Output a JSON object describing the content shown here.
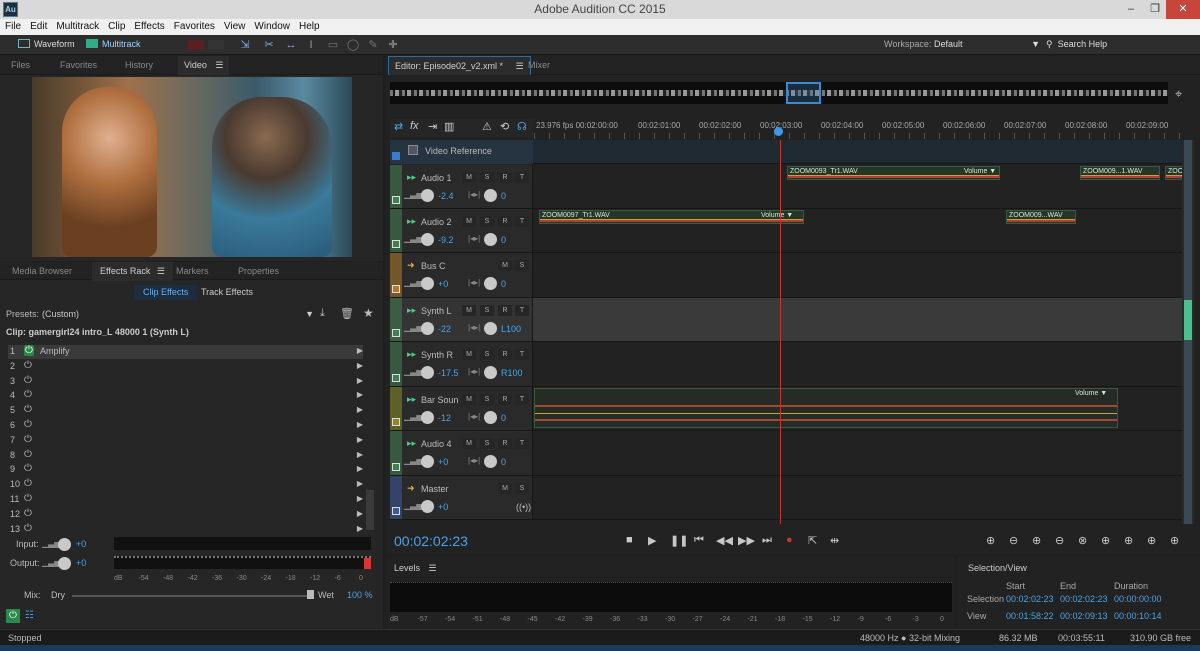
{
  "window": {
    "title": "Adobe Audition CC 2015",
    "app_icon": "Au",
    "minimize": "–",
    "restore": "❐",
    "close": "✕"
  },
  "menu": [
    "File",
    "Edit",
    "Multitrack",
    "Clip",
    "Effects",
    "Favorites",
    "View",
    "Window",
    "Help"
  ],
  "toolbar": {
    "waveform": "Waveform",
    "multitrack": "Multitrack",
    "workspace_label": "Workspace:",
    "workspace_value": "Default",
    "search_help": "Search Help"
  },
  "left_tabs": [
    "Files",
    "Favorites",
    "History",
    "Video"
  ],
  "rack_tabs": [
    "Media Browser",
    "Effects Rack",
    "Markers",
    "Properties"
  ],
  "rack": {
    "clip_effects": "Clip Effects",
    "track_effects": "Track Effects",
    "presets_label": "Presets:",
    "presets_value": "(Custom)",
    "clip_line": "Clip: gamergirl24 intro_L 48000 1 (Synth L)",
    "slots": [
      {
        "n": "1",
        "name": "Amplify"
      },
      {
        "n": "2",
        "name": ""
      },
      {
        "n": "3",
        "name": ""
      },
      {
        "n": "4",
        "name": ""
      },
      {
        "n": "5",
        "name": ""
      },
      {
        "n": "6",
        "name": ""
      },
      {
        "n": "7",
        "name": ""
      },
      {
        "n": "8",
        "name": ""
      },
      {
        "n": "9",
        "name": ""
      },
      {
        "n": "10",
        "name": ""
      },
      {
        "n": "11",
        "name": ""
      },
      {
        "n": "12",
        "name": ""
      },
      {
        "n": "13",
        "name": ""
      }
    ],
    "input_label": "Input:",
    "input_val": "+0",
    "output_label": "Output:",
    "output_val": "+0",
    "db_scale": [
      "dB",
      "-54",
      "-48",
      "-42",
      "-36",
      "-30",
      "-24",
      "-18",
      "-12",
      "-6",
      "0"
    ],
    "mix_label": "Mix:",
    "dry": "Dry",
    "wet": "Wet",
    "mix_pct": "100 %"
  },
  "editor_tabs": {
    "editor": "Editor: Episode02_v2.xml *",
    "mixer": "Mixer"
  },
  "ruler": {
    "fps": "23.976 fps 00:02:00:00",
    "ticks": [
      "00:02:01:00",
      "00:02:02:00",
      "00:02:03:00",
      "00:02:04:00",
      "00:02:05:00",
      "00:02:06:00",
      "00:02:07:00",
      "00:02:08:00",
      "00:02:09:00"
    ]
  },
  "video_ref": "Video Reference",
  "tracks": [
    {
      "name": "Audio 1",
      "vol": "-2.4",
      "pan": "0",
      "color": "#3f7f52"
    },
    {
      "name": "Audio 2",
      "vol": "-9.2",
      "pan": "0",
      "color": "#3f7f52"
    },
    {
      "name": "Bus C",
      "vol": "+0",
      "pan": "0",
      "color": "#b07a2c"
    },
    {
      "name": "Synth L",
      "vol": "-22",
      "pan": "L100",
      "color": "#3f7f52"
    },
    {
      "name": "Synth R",
      "vol": "-17.5",
      "pan": "R100",
      "color": "#3f7f52"
    },
    {
      "name": "Bar Soun",
      "vol": "-12",
      "pan": "0",
      "color": "#8a8a2a"
    },
    {
      "name": "Audio 4",
      "vol": "+0",
      "pan": "0",
      "color": "#3f7f52"
    },
    {
      "name": "Master",
      "vol": "+0",
      "pan": "",
      "color": "#3a5a9a"
    }
  ],
  "clips": {
    "c1": "ZOOM0093_Tr1.WAV",
    "c2": "ZOOM009...1.WAV",
    "c3": "ZOOM",
    "c4": "ZOOM0097_Tr1.WAV",
    "c5": "ZOOM009...WAV",
    "volume": "Volume"
  },
  "timecode": "00:02:02:23",
  "levels": {
    "title": "Levels",
    "scale": [
      "dB",
      "-57",
      "-54",
      "-51",
      "-48",
      "-45",
      "-42",
      "-39",
      "-36",
      "-33",
      "-30",
      "-27",
      "-24",
      "-21",
      "-18",
      "-15",
      "-12",
      "-9",
      "-6",
      "-3",
      "0"
    ]
  },
  "selection": {
    "title": "Selection/View",
    "start": "Start",
    "end": "End",
    "duration": "Duration",
    "sel_label": "Selection",
    "sel_start": "00:02:02:23",
    "sel_end": "00:02:02:23",
    "sel_dur": "00:00:00:00",
    "view_label": "View",
    "view_start": "00:01:58:22",
    "view_end": "00:02:09:13",
    "view_dur": "00:00:10:14"
  },
  "status": {
    "left": "Stopped",
    "rate": "48000 Hz ● 32-bit Mixing",
    "mem": "86.32 MB",
    "time": "00:03:55:11",
    "free": "310.90 GB free"
  },
  "colors": {
    "accent": "#4aa3e8",
    "playhead": "#c0392b",
    "clip_bg": "#253629"
  }
}
